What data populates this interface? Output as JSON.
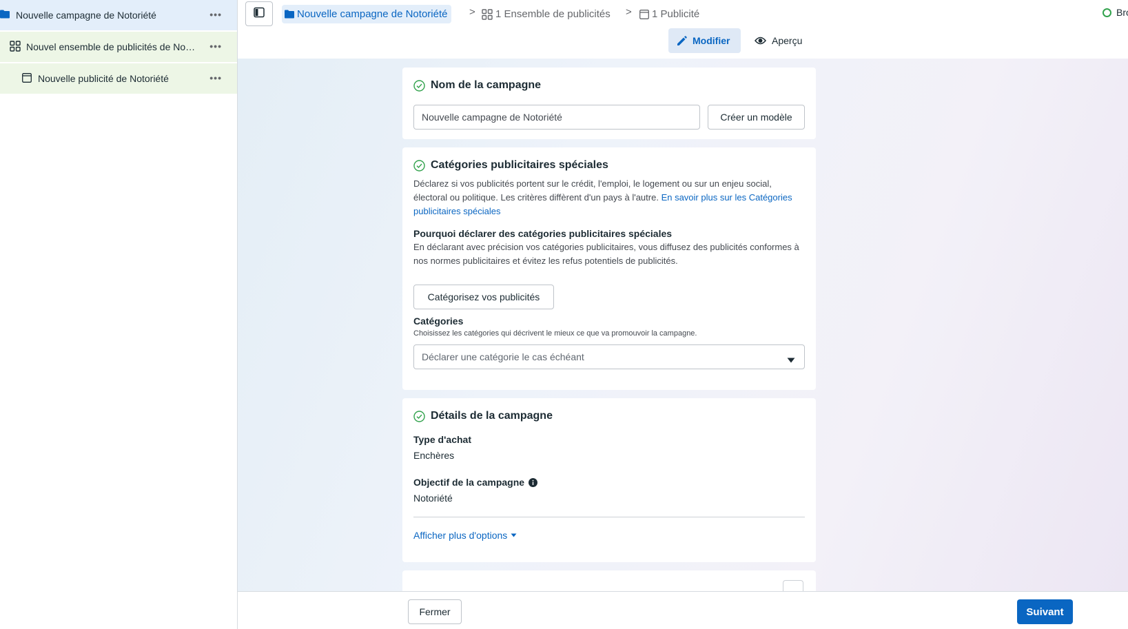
{
  "sidebar": {
    "items": [
      {
        "label": "Nouvelle campagne de Notoriété",
        "icon": "folder-icon",
        "more": "•••"
      },
      {
        "label": "Nouvel ensemble de publicités de Notoriété",
        "icon": "grid-icon",
        "more": "•••"
      },
      {
        "label": "Nouvelle publicité de Notoriété",
        "icon": "ad-icon",
        "more": "•••"
      }
    ]
  },
  "header": {
    "breadcrumb": [
      {
        "label": "Nouvelle campagne de Notoriété",
        "icon": "folder-icon"
      },
      {
        "label": "1 Ensemble de publicités",
        "icon": "grid-icon"
      },
      {
        "label": "1 Publicité",
        "icon": "ad-icon"
      }
    ],
    "separator": ">",
    "status": "Bro",
    "tabs": {
      "edit": "Modifier",
      "preview": "Aperçu"
    }
  },
  "campaign_name": {
    "title": "Nom de la campagne",
    "input_value": "Nouvelle campagne de Notoriété",
    "template_button": "Créer un modèle"
  },
  "special_categories": {
    "title": "Catégories publicitaires spéciales",
    "description": "Déclarez si vos publicités portent sur le crédit, l'emploi, le logement ou sur un enjeu social, électoral ou politique. Les critères diffèrent d'un pays à l'autre.",
    "learn_more": "En savoir plus sur les Catégories publicitaires spéciales",
    "why_title": "Pourquoi déclarer des catégories publicitaires spéciales",
    "why_text": "En déclarant avec précision vos catégories publicitaires, vous diffusez des publicités conformes à nos normes publicitaires et évitez les refus potentiels de publicités.",
    "categorize_button": "Catégorisez vos publicités",
    "categories_label": "Catégories",
    "categories_hint": "Choisissez les catégories qui décrivent le mieux ce que va promouvoir la campagne.",
    "select_placeholder": "Déclarer une catégorie le cas échéant"
  },
  "campaign_details": {
    "title": "Détails de la campagne",
    "purchase_type_label": "Type d'achat",
    "purchase_type_value": "Enchères",
    "objective_label": "Objectif de la campagne",
    "objective_value": "Notoriété",
    "more_options": "Afficher plus d'options"
  },
  "footer": {
    "close_button": "Fermer",
    "next_button": "Suivant"
  },
  "colors": {
    "accent": "#0a66c2",
    "sidebar_selected": "#e3eefa",
    "sidebar_child": "#edf6e6",
    "status_green": "#31a24c"
  }
}
